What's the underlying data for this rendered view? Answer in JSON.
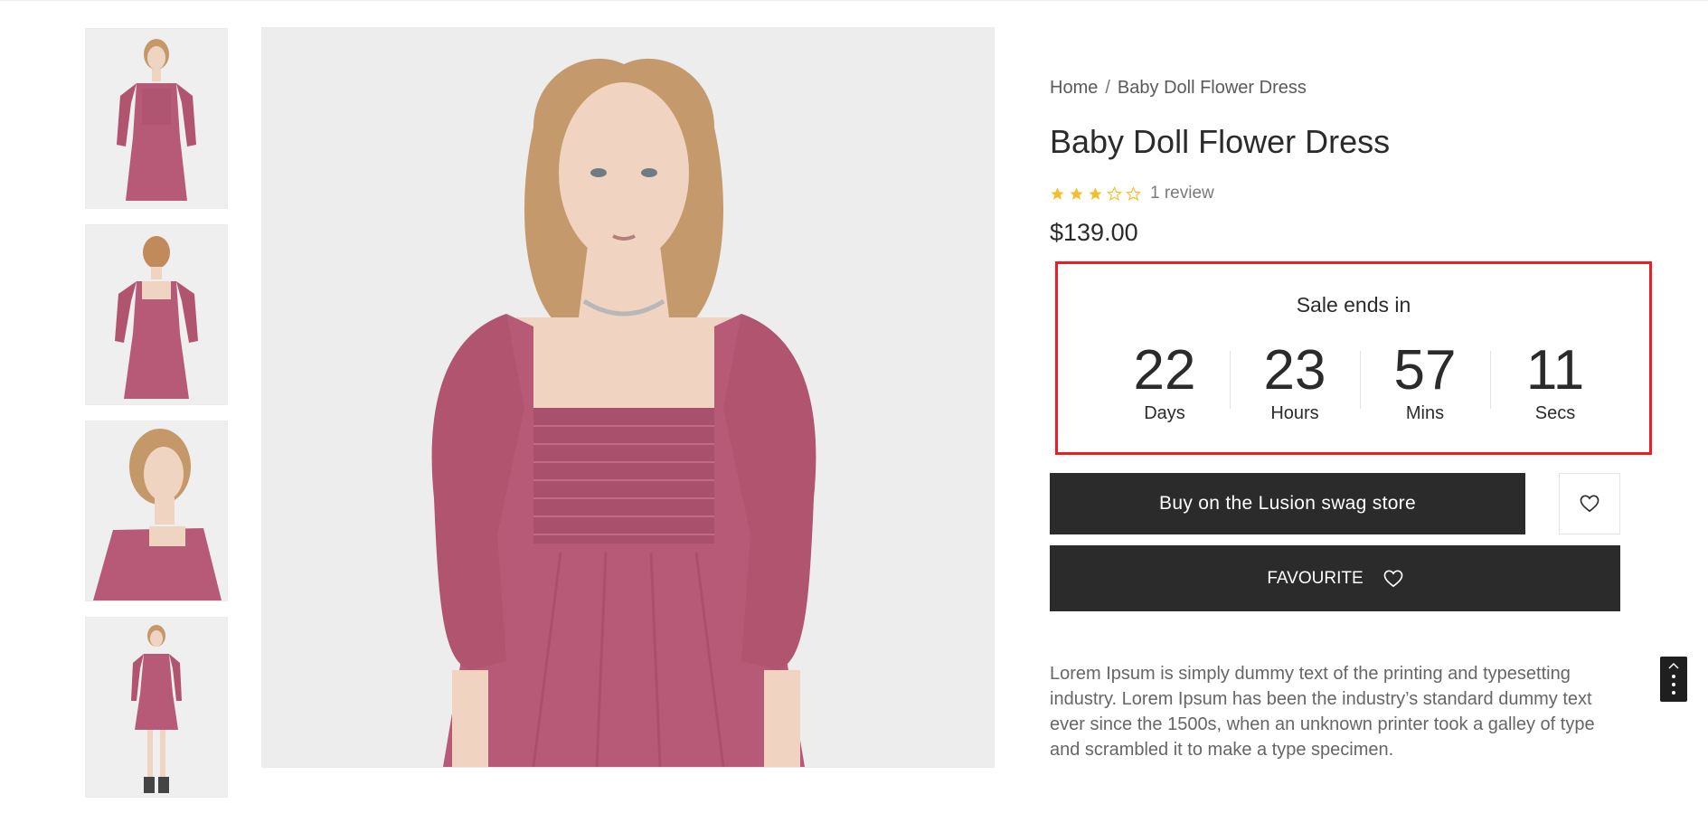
{
  "breadcrumb": {
    "home": "Home",
    "separator": "/",
    "current": "Baby Doll Flower Dress"
  },
  "product": {
    "title": "Baby Doll Flower Dress",
    "rating": 3,
    "rating_max": 5,
    "review_text": "1 review",
    "price": "$139.00",
    "description": "Lorem Ipsum is simply dummy text of the printing and typesetting industry. Lorem Ipsum has been the industry’s standard dummy text ever since the 1500s, when an unknown printer took a galley of type and scrambled it to make a type specimen."
  },
  "countdown": {
    "title": "Sale ends in",
    "units": [
      {
        "value": "22",
        "label": "Days"
      },
      {
        "value": "23",
        "label": "Hours"
      },
      {
        "value": "57",
        "label": "Mins"
      },
      {
        "value": "11",
        "label": "Secs"
      }
    ]
  },
  "actions": {
    "buy_label": "Buy on the Lusion swag store",
    "wishlist_icon": "heart-outline-icon",
    "favourite_label": "FAVOURITE",
    "favourite_icon": "heart-outline-icon"
  },
  "gallery": {
    "thumbnail_count": 4,
    "thumbnails": [
      "front-view",
      "back-view",
      "side-close-up",
      "full-length"
    ]
  },
  "colors": {
    "dress": "#b75a78",
    "button_dark": "#2b2b2b",
    "star": "#f5bd2a",
    "highlight_border": "#ee1c25"
  }
}
